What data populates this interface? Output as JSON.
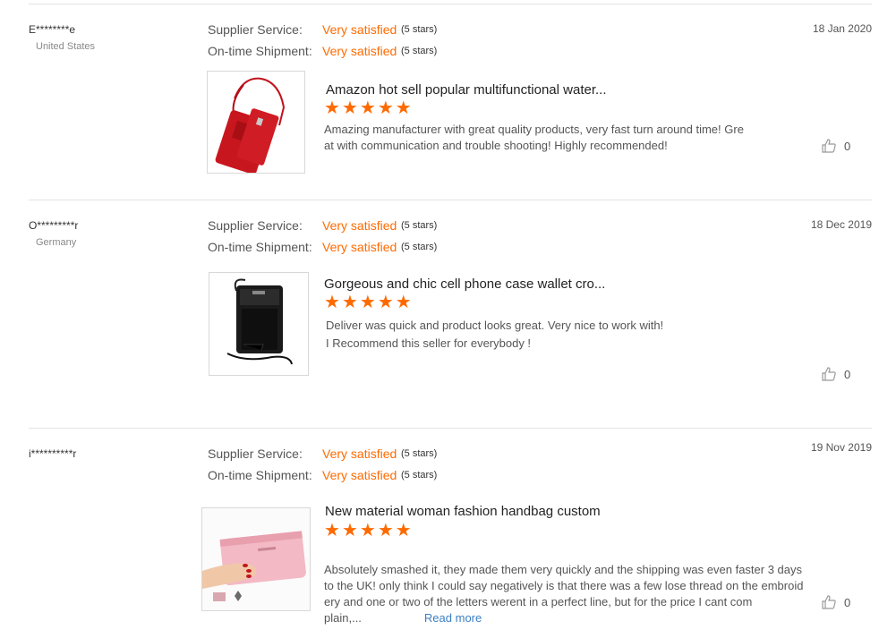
{
  "reviews": [
    {
      "user": "E********e",
      "country": "United States",
      "date": "18 Jan 2020",
      "supplier_label": "Supplier Service:",
      "supplier_value": "Very satisfied",
      "supplier_stars": "(5 stars)",
      "shipment_label": "On-time Shipment:",
      "shipment_value": "Very satisfied",
      "shipment_stars": "(5 stars)",
      "product_title": "Amazon hot sell popular multifunctional water...",
      "rating": 5,
      "text": "Amazing manufacturer with great quality products, very fast turn around time! Gre\nat with communication and trouble shooting! Highly recommended!",
      "likes": "0"
    },
    {
      "user": "O*********r",
      "country": "Germany",
      "date": "18 Dec 2019",
      "supplier_label": "Supplier Service:",
      "supplier_value": "Very satisfied",
      "supplier_stars": "(5 stars)",
      "shipment_label": "On-time Shipment:",
      "shipment_value": "Very satisfied",
      "shipment_stars": "(5 stars)",
      "product_title": "Gorgeous and chic cell phone case wallet cro...",
      "rating": 5,
      "text": "Deliver was quick and product looks great. Very nice to work with!\nI Recommend this seller for everybody !",
      "likes": "0"
    },
    {
      "user": "i**********r",
      "country": "",
      "date": "19 Nov 2019",
      "supplier_label": "Supplier Service:",
      "supplier_value": "Very satisfied",
      "supplier_stars": "(5 stars)",
      "shipment_label": "On-time Shipment:",
      "shipment_value": "Very satisfied",
      "shipment_stars": "(5 stars)",
      "product_title": "New material woman fashion handbag custom",
      "rating": 5,
      "text": "Absolutely smashed it, they made them very quickly and the shipping was even faster 3 days\nto the UK! only think I could say negatively is that there was a few lose thread on the embroid\nery and one or two of the letters werent in a perfect line, but for the price I cant com\nplain,...",
      "read_more": "Read more",
      "likes": "0"
    }
  ],
  "icons": {
    "like": "thumbs-up-icon",
    "star": "star-icon"
  },
  "colors": {
    "accent": "#ff6a00",
    "link": "#3b7fc4"
  }
}
